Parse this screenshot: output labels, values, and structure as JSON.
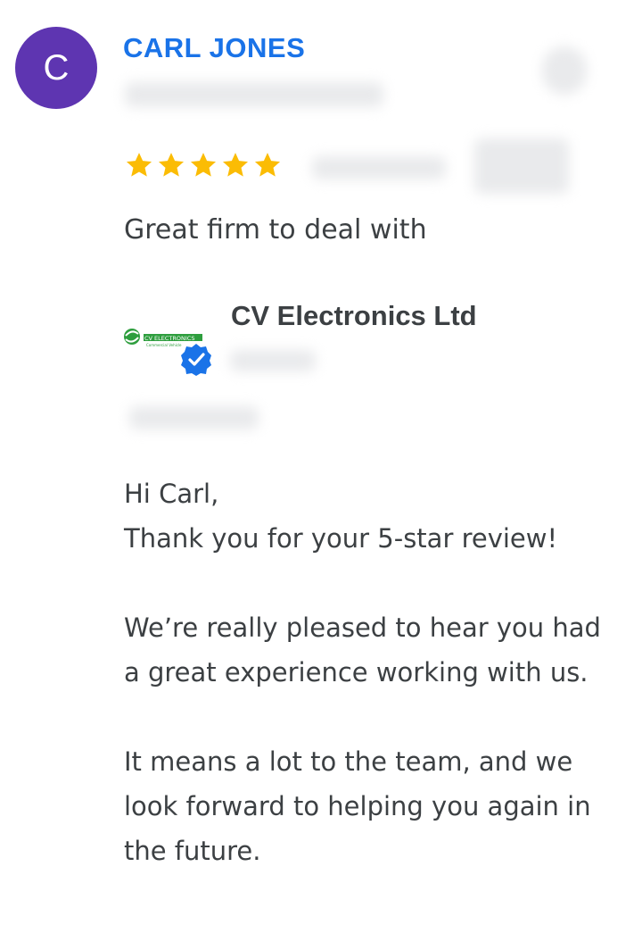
{
  "review": {
    "reviewer_initial": "C",
    "reviewer_name": "CARL JONES",
    "rating": 5,
    "rating_max": 5,
    "text": "Great firm to deal with"
  },
  "owner_reply": {
    "business_name": "CV Electronics Ltd",
    "logo_text": "CV ELECTRONICS",
    "logo_subtext": "Commercial Vehicle",
    "greeting": "Hi Carl,",
    "paragraph_1": "Thank you for your 5-star review!",
    "paragraph_2": "We’re really pleased to hear you had a great experience working with us.",
    "paragraph_3": "It means a lot to the team, and we look forward to helping you again in the future."
  },
  "colors": {
    "avatar_bg": "#5e35b1",
    "name_blue": "#1a73e8",
    "star": "#fbbc04",
    "verified": "#1a73e8",
    "logo_green": "#2e9e3e"
  }
}
